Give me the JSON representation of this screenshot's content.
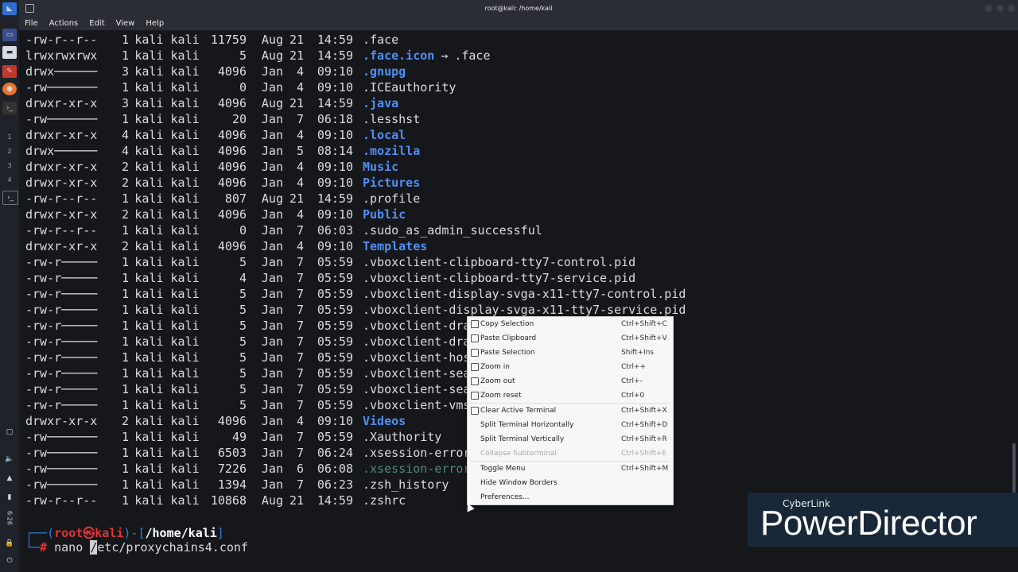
{
  "window": {
    "title": "root@kali: /home/kali"
  },
  "menubar": [
    "File",
    "Actions",
    "Edit",
    "View",
    "Help"
  ],
  "panel": {
    "workspaces": [
      "1",
      "2",
      "3",
      "4"
    ],
    "clock": "6:26"
  },
  "listing": [
    {
      "perm": "-rw-r--r--",
      "links": "1",
      "owner": "kali kali",
      "size": "11759",
      "month": "Aug",
      "day": "21",
      "time": "14:59",
      "name": ".face",
      "style": "file"
    },
    {
      "perm": "lrwxrwxrwx",
      "links": "1",
      "owner": "kali kali",
      "size": "5",
      "month": "Aug",
      "day": "21",
      "time": "14:59",
      "name": ".face.icon",
      "style": "link",
      "arrow": "→",
      "target": ".face"
    },
    {
      "perm": "drwx──────",
      "links": "3",
      "owner": "kali kali",
      "size": "4096",
      "month": "Jan",
      "day": "4",
      "time": "09:10",
      "name": ".gnupg",
      "style": "dir"
    },
    {
      "perm": "-rw───────",
      "links": "1",
      "owner": "kali kali",
      "size": "0",
      "month": "Jan",
      "day": "4",
      "time": "09:10",
      "name": ".ICEauthority",
      "style": "file"
    },
    {
      "perm": "drwxr-xr-x",
      "links": "3",
      "owner": "kali kali",
      "size": "4096",
      "month": "Aug",
      "day": "21",
      "time": "14:59",
      "name": ".java",
      "style": "dir"
    },
    {
      "perm": "-rw───────",
      "links": "1",
      "owner": "kali kali",
      "size": "20",
      "month": "Jan",
      "day": "7",
      "time": "06:18",
      "name": ".lesshst",
      "style": "file"
    },
    {
      "perm": "drwxr-xr-x",
      "links": "4",
      "owner": "kali kali",
      "size": "4096",
      "month": "Jan",
      "day": "4",
      "time": "09:10",
      "name": ".local",
      "style": "dir"
    },
    {
      "perm": "drwx──────",
      "links": "4",
      "owner": "kali kali",
      "size": "4096",
      "month": "Jan",
      "day": "5",
      "time": "08:14",
      "name": ".mozilla",
      "style": "dir"
    },
    {
      "perm": "drwxr-xr-x",
      "links": "2",
      "owner": "kali kali",
      "size": "4096",
      "month": "Jan",
      "day": "4",
      "time": "09:10",
      "name": "Music",
      "style": "dir"
    },
    {
      "perm": "drwxr-xr-x",
      "links": "2",
      "owner": "kali kali",
      "size": "4096",
      "month": "Jan",
      "day": "4",
      "time": "09:10",
      "name": "Pictures",
      "style": "dir"
    },
    {
      "perm": "-rw-r--r--",
      "links": "1",
      "owner": "kali kali",
      "size": "807",
      "month": "Aug",
      "day": "21",
      "time": "14:59",
      "name": ".profile",
      "style": "file"
    },
    {
      "perm": "drwxr-xr-x",
      "links": "2",
      "owner": "kali kali",
      "size": "4096",
      "month": "Jan",
      "day": "4",
      "time": "09:10",
      "name": "Public",
      "style": "dir"
    },
    {
      "perm": "-rw-r--r--",
      "links": "1",
      "owner": "kali kali",
      "size": "0",
      "month": "Jan",
      "day": "7",
      "time": "06:03",
      "name": ".sudo_as_admin_successful",
      "style": "file"
    },
    {
      "perm": "drwxr-xr-x",
      "links": "2",
      "owner": "kali kali",
      "size": "4096",
      "month": "Jan",
      "day": "4",
      "time": "09:10",
      "name": "Templates",
      "style": "dir"
    },
    {
      "perm": "-rw-r─────",
      "links": "1",
      "owner": "kali kali",
      "size": "5",
      "month": "Jan",
      "day": "7",
      "time": "05:59",
      "name": ".vboxclient-clipboard-tty7-control.pid",
      "style": "file"
    },
    {
      "perm": "-rw-r─────",
      "links": "1",
      "owner": "kali kali",
      "size": "4",
      "month": "Jan",
      "day": "7",
      "time": "05:59",
      "name": ".vboxclient-clipboard-tty7-service.pid",
      "style": "file"
    },
    {
      "perm": "-rw-r─────",
      "links": "1",
      "owner": "kali kali",
      "size": "5",
      "month": "Jan",
      "day": "7",
      "time": "05:59",
      "name": ".vboxclient-display-svga-x11-tty7-control.pid",
      "style": "file"
    },
    {
      "perm": "-rw-r─────",
      "links": "1",
      "owner": "kali kali",
      "size": "5",
      "month": "Jan",
      "day": "7",
      "time": "05:59",
      "name": ".vboxclient-display-svga-x11-tty7-service.pid",
      "style": "file"
    },
    {
      "perm": "-rw-r─────",
      "links": "1",
      "owner": "kali kali",
      "size": "5",
      "month": "Jan",
      "day": "7",
      "time": "05:59",
      "name": ".vboxclient-drag",
      "style": "file"
    },
    {
      "perm": "-rw-r─────",
      "links": "1",
      "owner": "kali kali",
      "size": "5",
      "month": "Jan",
      "day": "7",
      "time": "05:59",
      "name": ".vboxclient-drag",
      "style": "file"
    },
    {
      "perm": "-rw-r─────",
      "links": "1",
      "owner": "kali kali",
      "size": "5",
      "month": "Jan",
      "day": "7",
      "time": "05:59",
      "name": ".vboxclient-host",
      "style": "file"
    },
    {
      "perm": "-rw-r─────",
      "links": "1",
      "owner": "kali kali",
      "size": "5",
      "month": "Jan",
      "day": "7",
      "time": "05:59",
      "name": ".vboxclient-seam",
      "style": "file"
    },
    {
      "perm": "-rw-r─────",
      "links": "1",
      "owner": "kali kali",
      "size": "5",
      "month": "Jan",
      "day": "7",
      "time": "05:59",
      "name": ".vboxclient-seam",
      "style": "file"
    },
    {
      "perm": "-rw-r─────",
      "links": "1",
      "owner": "kali kali",
      "size": "5",
      "month": "Jan",
      "day": "7",
      "time": "05:59",
      "name": ".vboxclient-vmsv",
      "style": "file"
    },
    {
      "perm": "drwxr-xr-x",
      "links": "2",
      "owner": "kali kali",
      "size": "4096",
      "month": "Jan",
      "day": "4",
      "time": "09:10",
      "name": "Videos",
      "style": "dir"
    },
    {
      "perm": "-rw───────",
      "links": "1",
      "owner": "kali kali",
      "size": "49",
      "month": "Jan",
      "day": "7",
      "time": "05:59",
      "name": ".Xauthority",
      "style": "file"
    },
    {
      "perm": "-rw───────",
      "links": "1",
      "owner": "kali kali",
      "size": "6503",
      "month": "Jan",
      "day": "7",
      "time": "06:24",
      "name": ".xsession-errors",
      "style": "file"
    },
    {
      "perm": "-rw───────",
      "links": "1",
      "owner": "kali kali",
      "size": "7226",
      "month": "Jan",
      "day": "6",
      "time": "06:08",
      "name": ".xsession-errors",
      "style": "dim"
    },
    {
      "perm": "-rw───────",
      "links": "1",
      "owner": "kali kali",
      "size": "1394",
      "month": "Jan",
      "day": "7",
      "time": "06:23",
      "name": ".zsh_history",
      "style": "file"
    },
    {
      "perm": "-rw-r--r--",
      "links": "1",
      "owner": "kali kali",
      "size": "10868",
      "month": "Aug",
      "day": "21",
      "time": "14:59",
      "name": ".zshrc",
      "style": "file"
    }
  ],
  "prompt": {
    "open": "┌──(",
    "user": "root",
    "at": "㉿",
    "host": "kali",
    "mid": ")-[",
    "path": "/home/kali",
    "close": "]",
    "line2": "└─",
    "hash": "#",
    "cmd": "nano ",
    "cursor_char": "/",
    "cmd_rest": "etc/proxychains4.conf"
  },
  "context_menu": [
    {
      "label": "Copy Selection",
      "shortcut": "Ctrl+Shift+C",
      "icon": "copy-icon",
      "disabled": false
    },
    {
      "label": "Paste Clipboard",
      "shortcut": "Ctrl+Shift+V",
      "icon": "paste-icon",
      "disabled": false
    },
    {
      "label": "Paste Selection",
      "shortcut": "Shift+Ins",
      "icon": "paste-icon",
      "disabled": false
    },
    {
      "label": "Zoom in",
      "shortcut": "Ctrl++",
      "icon": "zoom-in-icon",
      "disabled": false
    },
    {
      "label": "Zoom out",
      "shortcut": "Ctrl+-",
      "icon": "zoom-out-icon",
      "disabled": false
    },
    {
      "label": "Zoom reset",
      "shortcut": "Ctrl+0",
      "icon": "zoom-reset-icon",
      "disabled": false
    },
    {
      "sep": true
    },
    {
      "label": "Clear Active Terminal",
      "shortcut": "Ctrl+Shift+X",
      "icon": "clear-icon",
      "disabled": false
    },
    {
      "label": "Split Terminal Horizontally",
      "shortcut": "Ctrl+Shift+D",
      "icon": "",
      "disabled": false
    },
    {
      "label": "Split Terminal Vertically",
      "shortcut": "Ctrl+Shift+R",
      "icon": "",
      "disabled": false
    },
    {
      "label": "Collapse Subterminal",
      "shortcut": "Ctrl+Shift+E",
      "icon": "",
      "disabled": true
    },
    {
      "sep": true
    },
    {
      "label": "Toggle Menu",
      "shortcut": "Ctrl+Shift+M",
      "icon": "",
      "disabled": false
    },
    {
      "label": "Hide Window Borders",
      "shortcut": "",
      "icon": "",
      "disabled": false
    },
    {
      "label": "Preferences...",
      "shortcut": "",
      "icon": "",
      "disabled": false
    }
  ],
  "watermark": {
    "small": "CyberLink",
    "big": "PowerDirector"
  }
}
